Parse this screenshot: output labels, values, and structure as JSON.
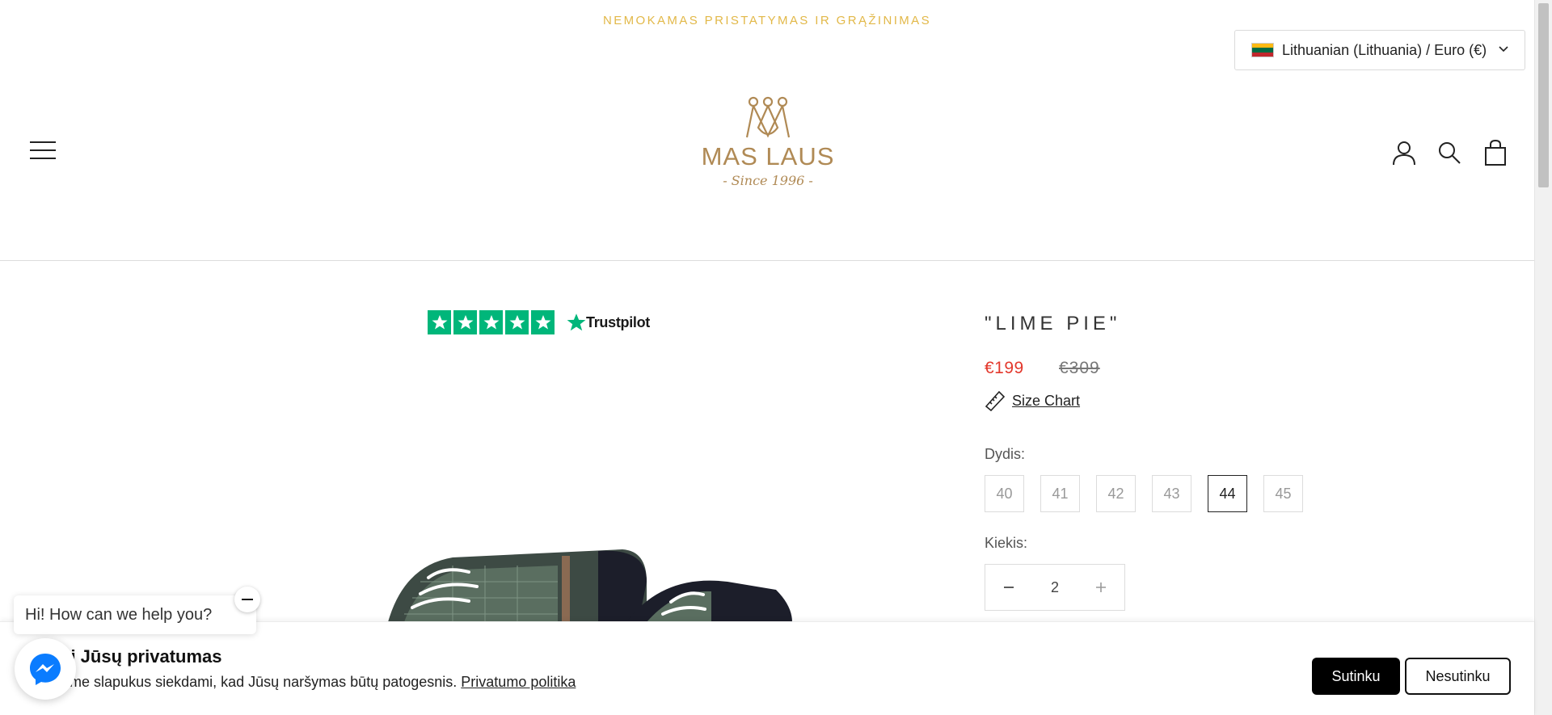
{
  "announcement": {
    "text": "NEMOKAMAS PRISTATYMAS IR GRĄŽINIMAS"
  },
  "locale": {
    "label": "Lithuanian (Lithuania) / Euro (€)",
    "flag_colors": [
      "#fdb913",
      "#006a44",
      "#c1272d"
    ]
  },
  "header": {
    "logo": {
      "brand": "MAS LAUS",
      "since": "- Since 1996 -"
    },
    "icons": [
      "menu-icon",
      "account-icon",
      "search-icon",
      "cart-icon"
    ]
  },
  "trustpilot": {
    "label": "Trustpilot",
    "stars": 5,
    "color": "#00b67a"
  },
  "product": {
    "title": "\"LIME PIE\"",
    "price": "€199",
    "compare_price": "€309",
    "size_chart_label": "Size Chart",
    "size_label": "Dydis:",
    "sizes": [
      "40",
      "41",
      "42",
      "43",
      "44",
      "45"
    ],
    "selected_size": "44",
    "quantity_label": "Kiekis:",
    "quantity": "2",
    "price_color": "#e3382c"
  },
  "cookie": {
    "title": "rūpi Jūsų privatumas",
    "text": "dojame slapukus siekdami, kad Jūsų naršymas būtų patogesnis.",
    "policy_link": "Privatumo politika",
    "accept_label": "Sutinku",
    "decline_label": "Nesutinku"
  },
  "chat": {
    "greeting": "Hi! How can we help you?"
  },
  "colors": {
    "accent_gold": "#e2b848",
    "brand_gold": "#b08a55",
    "messenger_blue": "#0a7cff"
  }
}
